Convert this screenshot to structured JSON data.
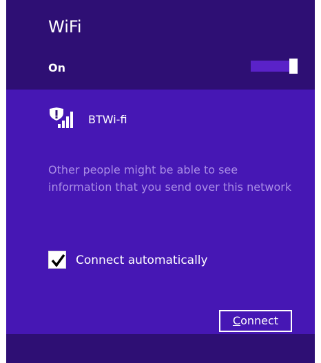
{
  "header": {
    "title": "WiFi",
    "status_label": "On",
    "toggle_on": true
  },
  "network": {
    "name": "BTWi-fi",
    "icon": "wifi-signal-shield-icon",
    "warning": "Other people might be able to see information that you send over this network",
    "connect_auto_label": "Connect automatically",
    "connect_auto_checked": true,
    "connect_button": {
      "underlined_letter": "C",
      "rest": "onnect"
    }
  },
  "colors": {
    "header_bg": "#2e0f74",
    "network_bg": "#4617b4",
    "warning_text": "#aa8ee6",
    "toggle_track": "#5a22c8"
  }
}
